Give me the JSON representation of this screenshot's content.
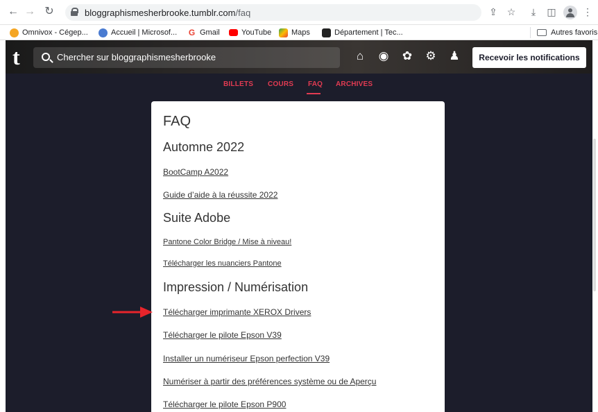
{
  "browser": {
    "url_host": "bloggraphismesherbrooke.tumblr.com",
    "url_path": "/faq",
    "bookmarks": [
      {
        "label": "Omnivox - Cégep...",
        "color": "#f5a623"
      },
      {
        "label": "Accueil | Microsof...",
        "color": "#4a7bd1"
      },
      {
        "label": "Gmail",
        "color": "#ea4335"
      },
      {
        "label": "YouTube",
        "color": "#ff0000"
      },
      {
        "label": "Maps",
        "color": "#34a853"
      },
      {
        "label": "Département | Tec...",
        "color": "#222222"
      }
    ],
    "other_bookmarks": "Autres favoris"
  },
  "tumblr": {
    "logo": "t",
    "search_placeholder": "Chercher sur bloggraphismesherbrooke",
    "notify_button": "Recevoir les notifications",
    "nav": [
      "BILLETS",
      "COURS",
      "FAQ",
      "ARCHIVES"
    ],
    "active_nav": "FAQ",
    "accent": "#e23b52"
  },
  "faq": {
    "title": "FAQ",
    "sections": [
      {
        "title": "Automne 2022",
        "links": [
          "BootCamp A2022",
          "Guide d’aide à la réussite 2022"
        ]
      },
      {
        "title": "Suite Adobe",
        "links": [
          "Pantone Color Bridge / Mise à niveau!",
          "Télécharger les nuanciers Pantone"
        ]
      },
      {
        "title": "Impression / Numérisation",
        "links": [
          "Télécharger imprimante XEROX Drivers",
          "Télécharger le pilote Epson V39",
          "Installer un numériseur Epson perfection V39",
          "Numériser à partir des préférences système ou de Aperçu",
          "Télécharger le pilote Epson P900"
        ]
      }
    ]
  }
}
